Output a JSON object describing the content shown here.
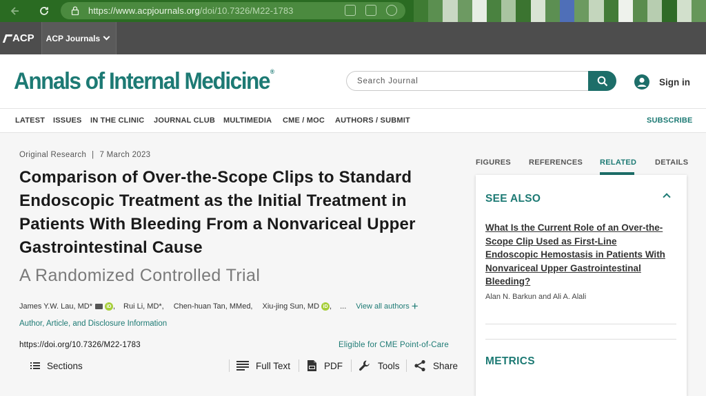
{
  "browser": {
    "url_host": "https://www.acpjournals.org",
    "url_path": "/doi/10.7326/M22-1783"
  },
  "acp_bar": {
    "logo": "ACP",
    "menu_label": "ACP Journals"
  },
  "header": {
    "journal_title": "Annals of Internal Medicine",
    "registered_mark": "®",
    "search_placeholder": "Search Journal",
    "signin_label": "Sign in"
  },
  "nav": {
    "items": [
      "LATEST",
      "ISSUES",
      "IN THE CLINIC",
      "JOURNAL CLUB",
      "MULTIMEDIA",
      "CME / MOC",
      "AUTHORS / SUBMIT"
    ],
    "subscribe": "SUBSCRIBE"
  },
  "article": {
    "type": "Original Research",
    "separator": "|",
    "date": "7 March 2023",
    "title": "Comparison of Over-the-Scope Clips to Standard Endoscopic Treatment as the Initial Treatment in Patients With Bleeding From a Nonvariceal Upper Gastrointestinal Cause",
    "subtitle": "A Randomized Controlled Trial",
    "authors": [
      "James Y.W. Lau, MD*",
      "Rui Li, MD*,",
      "Chen-huan Tan, MMed,",
      "Xiu-jing Sun, MD",
      "..."
    ],
    "comma": ",",
    "view_all_authors": "View all authors",
    "disclosure_link": "Author, Article, and Disclosure Information",
    "doi": "https://doi.org/10.7326/M22-1783",
    "cme_link": "Eligible for CME Point-of-Care"
  },
  "toolbar": {
    "sections": "Sections",
    "full_text": "Full Text",
    "pdf": "PDF",
    "tools": "Tools",
    "share": "Share"
  },
  "right_panel": {
    "tabs": [
      "FIGURES",
      "REFERENCES",
      "RELATED",
      "DETAILS"
    ],
    "active_tab": "RELATED",
    "see_also_heading": "SEE ALSO",
    "related_title": "What Is the Current Role of an Over-the-Scope Clip Used as First-Line Endoscopic Hemostasis in Patients With Nonvariceal Upper Gastrointestinal Bleeding?",
    "related_authors": "Alan N. Barkun and Ali A. Alali",
    "metrics_heading": "METRICS"
  },
  "colors": {
    "brand_teal": "#1d7a74",
    "browser_green": "#2a6b22",
    "acp_gray": "#4d4d4d"
  }
}
